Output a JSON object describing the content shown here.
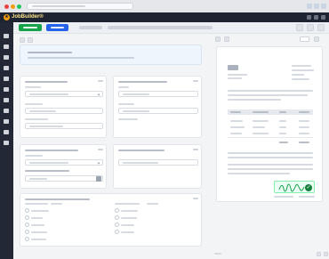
{
  "app": {
    "name": "JobBuilder",
    "trademark": "®"
  },
  "icons": {
    "logo": "jobbuilder-logo-icon",
    "browser_close": "close-window-icon",
    "browser_min": "minimize-window-icon",
    "browser_max": "maximize-window-icon",
    "sidebar": [
      "home-icon",
      "jobs-icon",
      "documents-icon",
      "calendar-icon",
      "users-icon",
      "reports-icon",
      "files-icon",
      "settings-icon",
      "help-icon",
      "tools-icon",
      "messages-icon"
    ],
    "preview_tools": [
      "view-icon",
      "grid-icon",
      "zoom-icon",
      "download-icon"
    ],
    "signature_check": "check-icon"
  },
  "colors": {
    "primary_green": "#16a34a",
    "primary_blue": "#2563eb",
    "header_bg": "#1f2433",
    "logo_yellow": "#f59e0b",
    "signature_green": "#15803d"
  }
}
